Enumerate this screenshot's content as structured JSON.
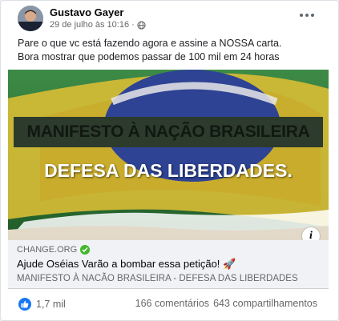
{
  "post": {
    "author": "Gustavo Gayer",
    "date": "29 de julho às 10:16",
    "separator": "·",
    "audience_icon": "globe-icon",
    "text_lines": [
      "Pare o que vc está fazendo agora e assine a NOSSA carta.",
      "Bora mostrar que podemos passar de 100 mil em 24 horas"
    ]
  },
  "image": {
    "line1": "MANIFESTO À NAÇÃO BRASILEIRA",
    "line2": "DEFESA DAS LIBERDADES.",
    "info_label": "i",
    "colors": {
      "green": "#2b6e3a",
      "yellow": "#e0c23a",
      "blue": "#2b3f8c"
    }
  },
  "link": {
    "domain": "CHANGE.ORG",
    "title": "Ajude Oséias Varão a bombar essa petição! 🚀",
    "description": "MANIFESTO À NACÃO BRASILEIRA - DEFESA DAS LIBERDADES"
  },
  "stats": {
    "likes": "1,7 mil",
    "comments": "166 comentários",
    "shares": "643 compartilhamentos"
  },
  "colors": {
    "accent": "#1877f2",
    "verified": "#42b72a"
  }
}
